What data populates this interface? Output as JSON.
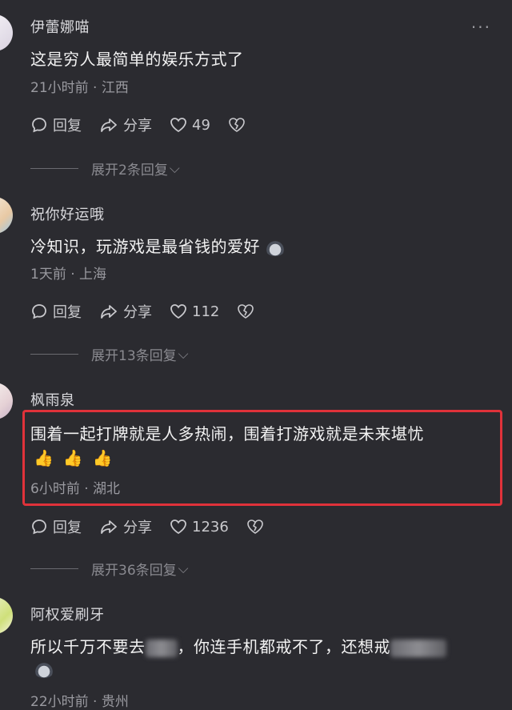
{
  "menu_icon": "more-dots-icon",
  "labels": {
    "reply": "回复",
    "share": "分享"
  },
  "comments": [
    {
      "username": "伊蕾娜喵",
      "text": "这是穷人最简单的娱乐方式了",
      "meta": "21小时前 · 江西",
      "likes": "49",
      "expand": "展开2条回复"
    },
    {
      "username": "祝你好运哦",
      "text": "冷知识，玩游戏是最省钱的爱好",
      "meta": "1天前 · 上海",
      "likes": "112",
      "expand": "展开13条回复"
    },
    {
      "username": "枫雨泉",
      "text": "围着一起打牌就是人多热闹，围着打游戏就是未来堪忧",
      "emojis": [
        "👍",
        "👍",
        "👍"
      ],
      "meta": "6小时前 · 湖北",
      "likes": "1236",
      "expand": "展开36条回复"
    },
    {
      "username": "阿权爱刷牙",
      "text_part1": "所以千万不要去",
      "text_part2": "，你连手机都戒不了，还想戒",
      "meta": "22小时前 · 贵州"
    }
  ],
  "colors": {
    "background": "#2b2b30",
    "highlight_border": "#e0323a"
  }
}
